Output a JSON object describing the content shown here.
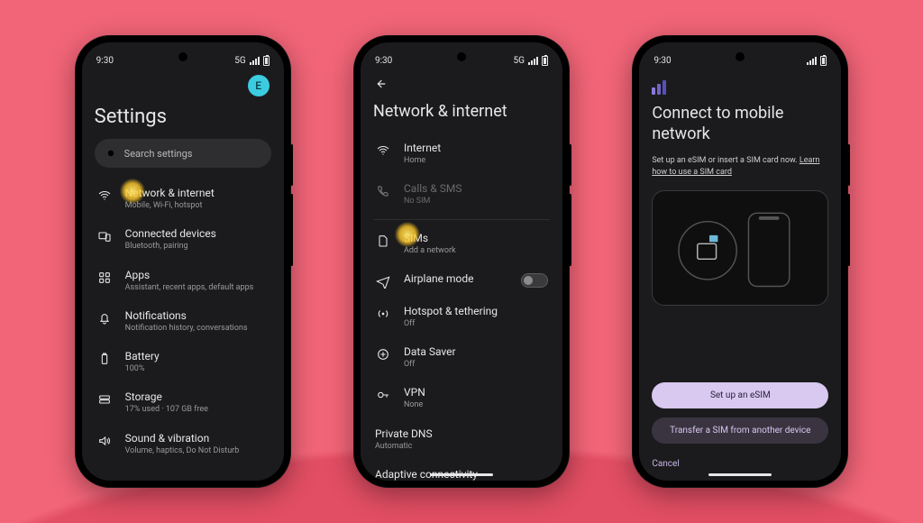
{
  "status": {
    "time": "9:30",
    "network": "5G"
  },
  "phone1": {
    "avatar": "E",
    "title": "Settings",
    "search_placeholder": "Search settings",
    "items": [
      {
        "t": "Network & internet",
        "s": "Mobile, Wi-Fi, hotspot"
      },
      {
        "t": "Connected devices",
        "s": "Bluetooth, pairing"
      },
      {
        "t": "Apps",
        "s": "Assistant, recent apps, default apps"
      },
      {
        "t": "Notifications",
        "s": "Notification history, conversations"
      },
      {
        "t": "Battery",
        "s": "100%"
      },
      {
        "t": "Storage",
        "s": "17% used · 107 GB free"
      },
      {
        "t": "Sound & vibration",
        "s": "Volume, haptics, Do Not Disturb"
      }
    ]
  },
  "phone2": {
    "title": "Network & internet",
    "items": [
      {
        "t": "Internet",
        "s": "Home"
      },
      {
        "t": "Calls & SMS",
        "s": "No SIM"
      },
      {
        "t": "SIMs",
        "s": "Add a network"
      },
      {
        "t": "Airplane mode",
        "s": ""
      },
      {
        "t": "Hotspot & tethering",
        "s": "Off"
      },
      {
        "t": "Data Saver",
        "s": "Off"
      },
      {
        "t": "VPN",
        "s": "None"
      },
      {
        "t": "Private DNS",
        "s": "Automatic"
      },
      {
        "t": "Adaptive connectivity",
        "s": ""
      }
    ]
  },
  "phone3": {
    "title": "Connect to mobile network",
    "body_before": "Set up an eSIM or insert a SIM card now. ",
    "link": "Learn how to use a SIM card",
    "primary": "Set up an eSIM",
    "secondary": "Transfer a SIM from another device",
    "cancel": "Cancel"
  }
}
